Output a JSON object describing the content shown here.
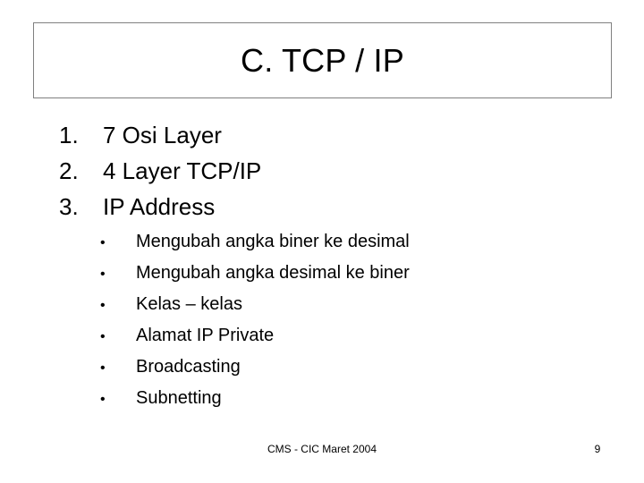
{
  "slide": {
    "background_color": "#ffffff",
    "text_color": "#000000",
    "title_border_color": "#808080"
  },
  "title": {
    "text": "C. TCP / IP"
  },
  "numbered_list": [
    {
      "marker": "1.",
      "label": "7 Osi Layer"
    },
    {
      "marker": "2.",
      "label": "4 Layer TCP/IP"
    },
    {
      "marker": "3.",
      "label": "IP Address"
    }
  ],
  "bullet_list": [
    {
      "marker": "•",
      "label": "Mengubah angka biner ke desimal"
    },
    {
      "marker": "•",
      "label": "Mengubah angka desimal ke biner"
    },
    {
      "marker": "•",
      "label": "Kelas – kelas"
    },
    {
      "marker": "•",
      "label": "Alamat IP Private"
    },
    {
      "marker": "•",
      "label": "Broadcasting"
    },
    {
      "marker": "•",
      "label": "Subnetting"
    }
  ],
  "footer": {
    "text": "CMS - CIC Maret 2004",
    "page_number": "9"
  }
}
